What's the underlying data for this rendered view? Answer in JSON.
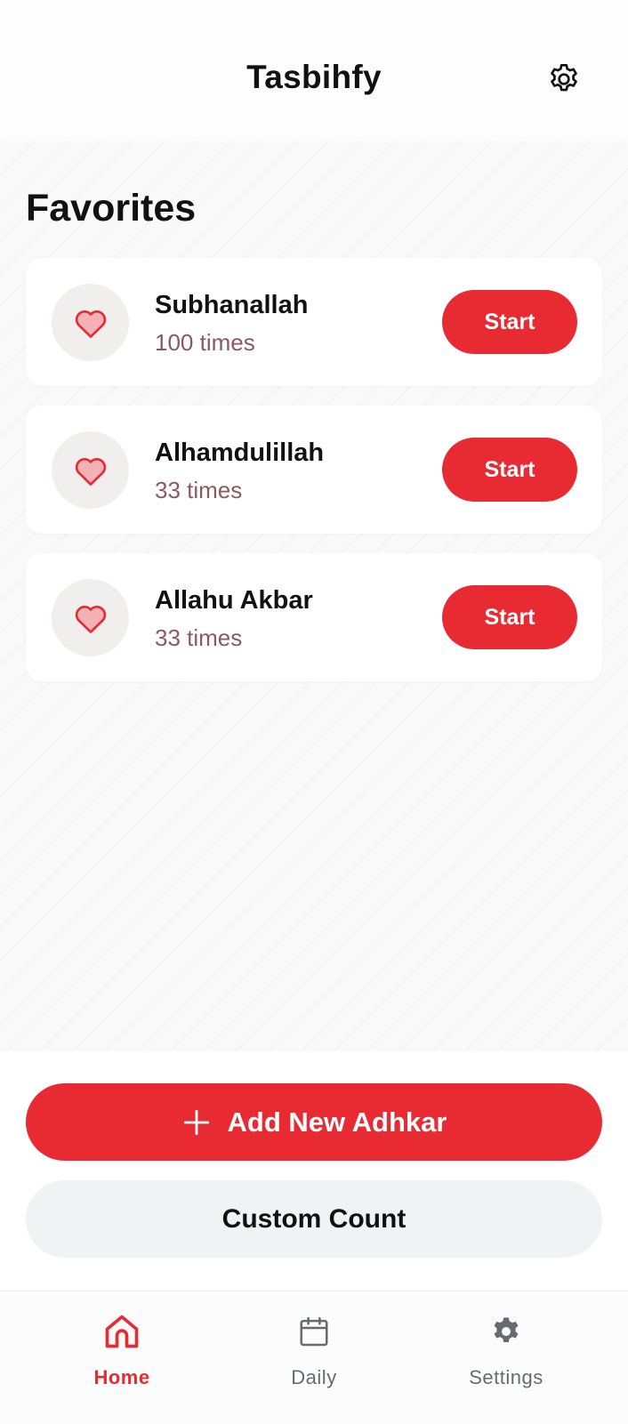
{
  "header": {
    "title": "Tasbihfy",
    "settings_icon": "gear-icon"
  },
  "favorites": {
    "title": "Favorites",
    "items": [
      {
        "title": "Subhanallah",
        "count": "100 times",
        "button": "Start",
        "icon": "heart-icon"
      },
      {
        "title": "Alhamdulillah",
        "count": "33 times",
        "button": "Start",
        "icon": "heart-icon"
      },
      {
        "title": "Allahu Akbar",
        "count": "33 times",
        "button": "Start",
        "icon": "heart-icon"
      }
    ]
  },
  "actions": {
    "add_label": "Add New Adhkar",
    "add_icon": "plus-icon",
    "custom_label": "Custom Count"
  },
  "nav": {
    "items": [
      {
        "label": "Home",
        "icon": "home-icon",
        "active": true
      },
      {
        "label": "Daily",
        "icon": "calendar-icon",
        "active": false
      },
      {
        "label": "Settings",
        "icon": "gear-icon",
        "active": false
      }
    ]
  },
  "colors": {
    "accent": "#e82a33",
    "heart_fill": "#f4b2b6",
    "count_text": "#8a5a5e",
    "nav_inactive": "#666b72"
  }
}
